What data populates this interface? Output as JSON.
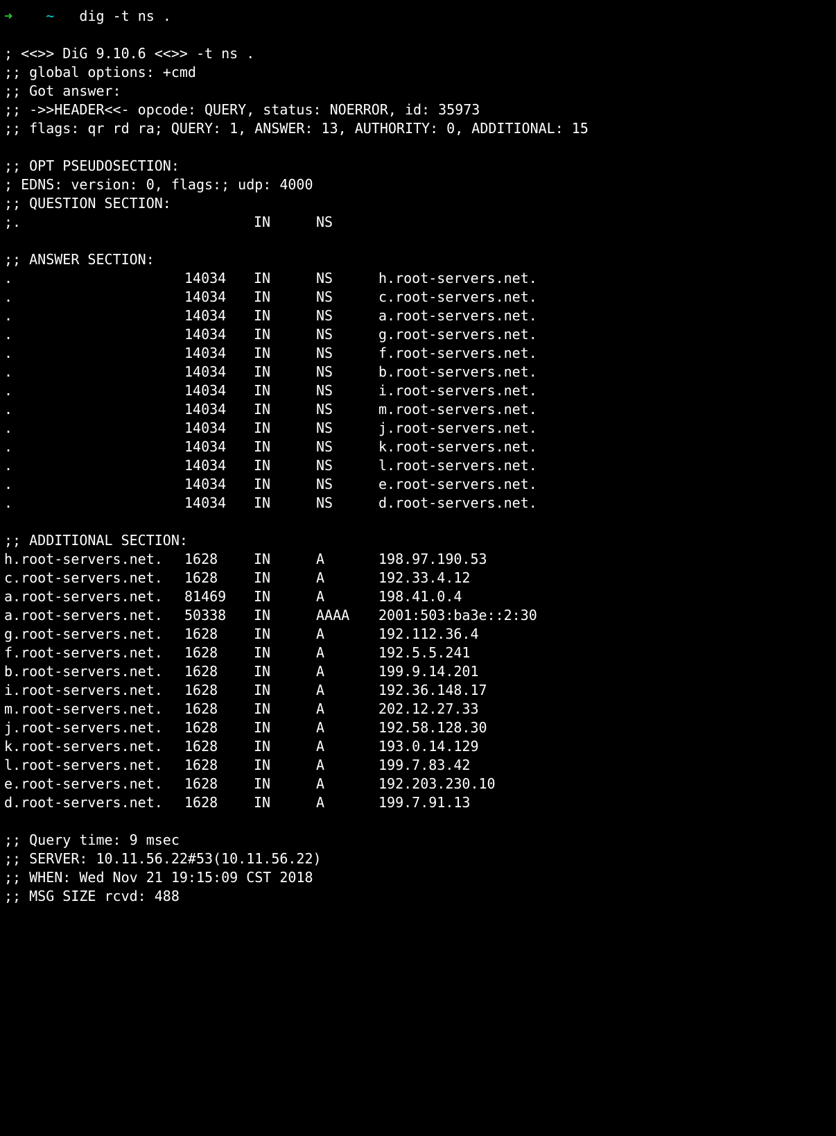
{
  "prompt": {
    "arrow": "➜",
    "tilde": "~",
    "command": "dig -t ns ."
  },
  "banner": {
    "line1": "; <<>> DiG 9.10.6 <<>> -t ns .",
    "line2": ";; global options: +cmd",
    "line3": ";; Got answer:",
    "line4": ";; ->>HEADER<<- opcode: QUERY, status: NOERROR, id: 35973",
    "line5": ";; flags: qr rd ra; QUERY: 1, ANSWER: 13, AUTHORITY: 0, ADDITIONAL: 15"
  },
  "opt": {
    "hdr": ";; OPT PSEUDOSECTION:",
    "edns": "; EDNS: version: 0, flags:; udp: 4000"
  },
  "question": {
    "hdr": ";; QUESTION SECTION:",
    "row": {
      "name": ";.",
      "ttl": "",
      "class": "IN",
      "type": "NS",
      "data": ""
    }
  },
  "answer": {
    "hdr": ";; ANSWER SECTION:",
    "rows": [
      {
        "name": ".",
        "ttl": "14034",
        "class": "IN",
        "type": "NS",
        "data": "h.root-servers.net."
      },
      {
        "name": ".",
        "ttl": "14034",
        "class": "IN",
        "type": "NS",
        "data": "c.root-servers.net."
      },
      {
        "name": ".",
        "ttl": "14034",
        "class": "IN",
        "type": "NS",
        "data": "a.root-servers.net."
      },
      {
        "name": ".",
        "ttl": "14034",
        "class": "IN",
        "type": "NS",
        "data": "g.root-servers.net."
      },
      {
        "name": ".",
        "ttl": "14034",
        "class": "IN",
        "type": "NS",
        "data": "f.root-servers.net."
      },
      {
        "name": ".",
        "ttl": "14034",
        "class": "IN",
        "type": "NS",
        "data": "b.root-servers.net."
      },
      {
        "name": ".",
        "ttl": "14034",
        "class": "IN",
        "type": "NS",
        "data": "i.root-servers.net."
      },
      {
        "name": ".",
        "ttl": "14034",
        "class": "IN",
        "type": "NS",
        "data": "m.root-servers.net."
      },
      {
        "name": ".",
        "ttl": "14034",
        "class": "IN",
        "type": "NS",
        "data": "j.root-servers.net."
      },
      {
        "name": ".",
        "ttl": "14034",
        "class": "IN",
        "type": "NS",
        "data": "k.root-servers.net."
      },
      {
        "name": ".",
        "ttl": "14034",
        "class": "IN",
        "type": "NS",
        "data": "l.root-servers.net."
      },
      {
        "name": ".",
        "ttl": "14034",
        "class": "IN",
        "type": "NS",
        "data": "e.root-servers.net."
      },
      {
        "name": ".",
        "ttl": "14034",
        "class": "IN",
        "type": "NS",
        "data": "d.root-servers.net."
      }
    ]
  },
  "additional": {
    "hdr": ";; ADDITIONAL SECTION:",
    "rows": [
      {
        "name": "h.root-servers.net.",
        "ttl": "1628",
        "class": "IN",
        "type": "A",
        "data": "198.97.190.53"
      },
      {
        "name": "c.root-servers.net.",
        "ttl": "1628",
        "class": "IN",
        "type": "A",
        "data": "192.33.4.12"
      },
      {
        "name": "a.root-servers.net.",
        "ttl": "81469",
        "class": "IN",
        "type": "A",
        "data": "198.41.0.4"
      },
      {
        "name": "a.root-servers.net.",
        "ttl": "50338",
        "class": "IN",
        "type": "AAAA",
        "data": "2001:503:ba3e::2:30"
      },
      {
        "name": "g.root-servers.net.",
        "ttl": "1628",
        "class": "IN",
        "type": "A",
        "data": "192.112.36.4"
      },
      {
        "name": "f.root-servers.net.",
        "ttl": "1628",
        "class": "IN",
        "type": "A",
        "data": "192.5.5.241"
      },
      {
        "name": "b.root-servers.net.",
        "ttl": "1628",
        "class": "IN",
        "type": "A",
        "data": "199.9.14.201"
      },
      {
        "name": "i.root-servers.net.",
        "ttl": "1628",
        "class": "IN",
        "type": "A",
        "data": "192.36.148.17"
      },
      {
        "name": "m.root-servers.net.",
        "ttl": "1628",
        "class": "IN",
        "type": "A",
        "data": "202.12.27.33"
      },
      {
        "name": "j.root-servers.net.",
        "ttl": "1628",
        "class": "IN",
        "type": "A",
        "data": "192.58.128.30"
      },
      {
        "name": "k.root-servers.net.",
        "ttl": "1628",
        "class": "IN",
        "type": "A",
        "data": "193.0.14.129"
      },
      {
        "name": "l.root-servers.net.",
        "ttl": "1628",
        "class": "IN",
        "type": "A",
        "data": "199.7.83.42"
      },
      {
        "name": "e.root-servers.net.",
        "ttl": "1628",
        "class": "IN",
        "type": "A",
        "data": "192.203.230.10"
      },
      {
        "name": "d.root-servers.net.",
        "ttl": "1628",
        "class": "IN",
        "type": "A",
        "data": "199.7.91.13"
      }
    ]
  },
  "footer": {
    "qtime": ";; Query time: 9 msec",
    "server": ";; SERVER: 10.11.56.22#53(10.11.56.22)",
    "when": ";; WHEN: Wed Nov 21 19:15:09 CST 2018",
    "msg": ";; MSG SIZE  rcvd: 488"
  }
}
